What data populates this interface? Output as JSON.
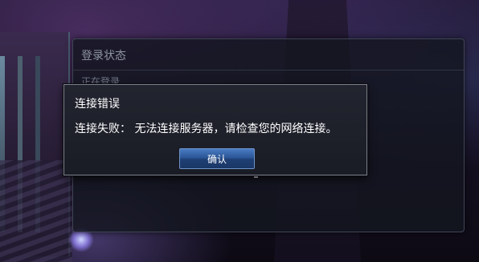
{
  "login_status": {
    "title": "登录状态",
    "message": "正在登录……"
  },
  "error_dialog": {
    "title": "连接错误",
    "message": "连接失败： 无法连接服务器，请检查您的网络连接。",
    "confirm_label": "确认"
  },
  "colors": {
    "dialog_background": "#1e2029",
    "button_blue": "#2b5596",
    "text_white": "#ffffff"
  }
}
